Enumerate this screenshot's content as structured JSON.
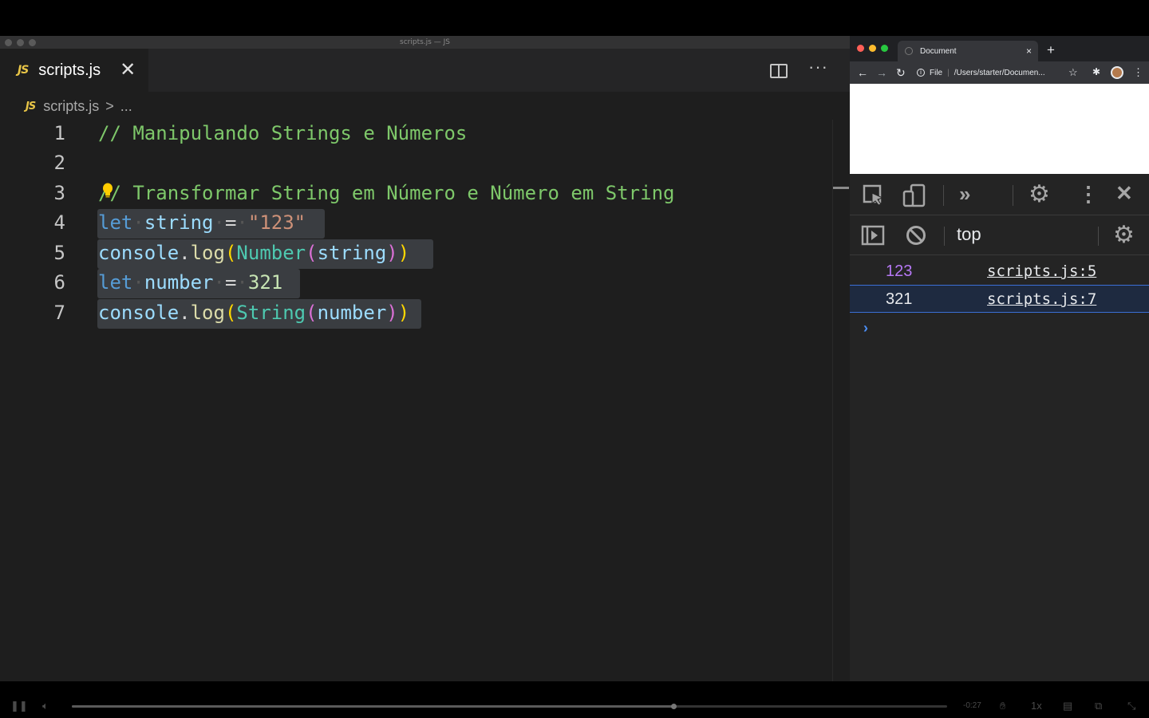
{
  "vscode": {
    "window_title": "scripts.js — JS",
    "tab": {
      "badge": "JS",
      "label": "scripts.js",
      "close": "✕"
    },
    "breadcrumb": {
      "badge": "JS",
      "file": "scripts.js",
      "separator": ">",
      "more": "..."
    },
    "more_actions": "···",
    "lines": [
      {
        "number": "1"
      },
      {
        "number": "2"
      },
      {
        "number": "3"
      },
      {
        "number": "4"
      },
      {
        "number": "5"
      },
      {
        "number": "6"
      },
      {
        "number": "7"
      }
    ],
    "code": {
      "l1_comment": "// Manipulando Strings e Números",
      "l3_comment": "// Transformar String em Número e Número em String",
      "l4": {
        "kw": "let",
        "var": "string",
        "eq": "=",
        "str": "\"123\""
      },
      "l5": {
        "obj": "console",
        "dot": ".",
        "fn": "log",
        "p1o": "(",
        "type": "Number",
        "p2o": "(",
        "arg": "string",
        "p2c": ")",
        "p1c": ")"
      },
      "l6": {
        "kw": "let",
        "var": "number",
        "eq": "=",
        "num": "321"
      },
      "l7": {
        "obj": "console",
        "dot": ".",
        "fn": "log",
        "p1o": "(",
        "type": "String",
        "p2o": "(",
        "arg": "number",
        "p2c": ")",
        "p1c": ")"
      },
      "ws_dot": "·"
    }
  },
  "chrome": {
    "tab_title": "Document",
    "tab_close": "×",
    "new_tab": "+",
    "omnibox": {
      "info": "i",
      "scheme": "File",
      "url": "/Users/starter/Documen..."
    },
    "devtools": {
      "more_tabs": "»",
      "context": "top",
      "console": [
        {
          "value": "123",
          "source": "scripts.js:5",
          "color": "#b678f5"
        },
        {
          "value": "321",
          "source": "scripts.js:7",
          "color": "#e8eaed"
        }
      ],
      "prompt": "›"
    }
  },
  "player": {
    "time_remaining": "-0:27",
    "speed": "1x",
    "progress": 0.687
  }
}
